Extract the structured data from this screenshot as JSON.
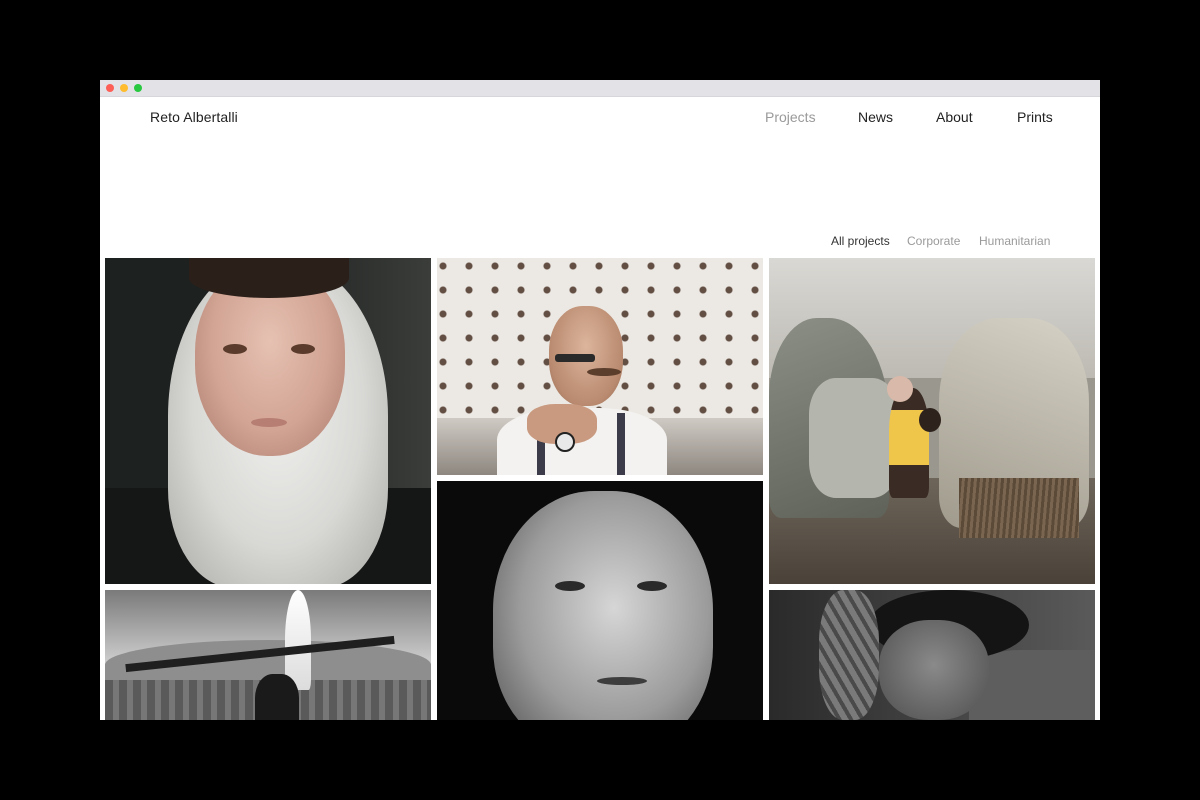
{
  "site": {
    "title": "Reto Albertalli"
  },
  "nav": {
    "items": [
      {
        "label": "Projects",
        "active": true
      },
      {
        "label": "News",
        "active": false
      },
      {
        "label": "About",
        "active": false
      },
      {
        "label": "Prints",
        "active": false
      }
    ]
  },
  "filters": {
    "items": [
      {
        "label": "All projects",
        "active": true
      },
      {
        "label": "Corporate",
        "active": false
      },
      {
        "label": "Humanitarian",
        "active": false
      }
    ]
  },
  "gallery": {
    "photos": [
      {
        "subject": "portrait of young woman in white headscarf"
      },
      {
        "subject": "tattooed man in front of wall of crosses"
      },
      {
        "subject": "children standing by makeshift tents"
      },
      {
        "subject": "black and white portrait of older man"
      },
      {
        "subject": "person with arms raised before fountain"
      },
      {
        "subject": "man with tattooed arm over head"
      }
    ]
  },
  "colors": {
    "background": "#000000",
    "page": "#ffffff",
    "text": "#222222",
    "muted": "#9a9a9a"
  }
}
